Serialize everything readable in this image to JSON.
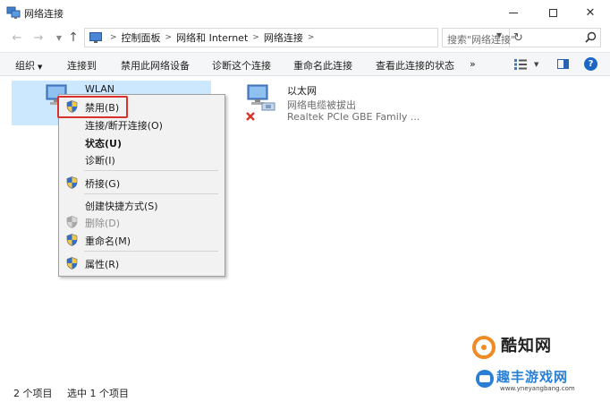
{
  "window": {
    "title": "网络连接",
    "controls": {
      "minimize": "minimize",
      "maximize": "maximize",
      "close": "✕"
    }
  },
  "address_bar": {
    "breadcrumbs": [
      "控制面板",
      "网络和 Internet",
      "网络连接"
    ],
    "search_placeholder": "搜索\"网络连接\""
  },
  "toolbar": {
    "organize": "组织",
    "connect_to": "连接到",
    "disable_device": "禁用此网络设备",
    "diagnose": "诊断这个连接",
    "rename": "重命名此连接",
    "view_status": "查看此连接的状态",
    "more": "»"
  },
  "connections": [
    {
      "name": "WLAN",
      "status": "",
      "adapter": "",
      "selected": true
    },
    {
      "name": "以太网",
      "status": "网络电缆被拔出",
      "adapter": "Realtek PCIe GBE Family ..."
    }
  ],
  "context_menu": {
    "items": [
      {
        "label": "禁用(B)",
        "shield": true,
        "highlighted": true
      },
      {
        "label": "连接/断开连接(O)"
      },
      {
        "label": "状态(U)",
        "bold": true
      },
      {
        "label": "诊断(I)"
      },
      {
        "label": "桥接(G)",
        "shield": true
      },
      {
        "label": "创建快捷方式(S)"
      },
      {
        "label": "删除(D)",
        "shield": true,
        "disabled": true
      },
      {
        "label": "重命名(M)",
        "shield": true
      },
      {
        "label": "属性(R)",
        "shield": true
      }
    ]
  },
  "status_bar": {
    "item_count": "2 个项目",
    "selected_count": "选中 1 个项目"
  },
  "watermark": {
    "line1": "酷知网",
    "line2": "趣丰游戏网",
    "url": "www.yneyangbang.com"
  },
  "colors": {
    "selection": "#cce8ff",
    "highlight_box": "#d8322c",
    "help_blue": "#1b67c6"
  }
}
